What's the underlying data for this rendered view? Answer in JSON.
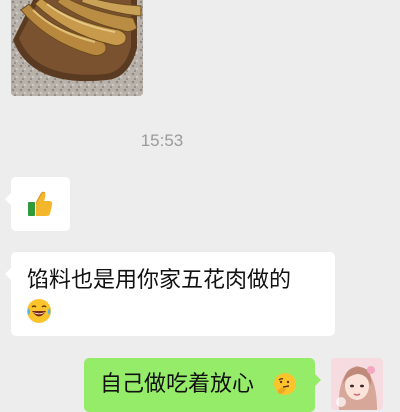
{
  "chat": {
    "timestamp": "15:53",
    "messages": [
      {
        "side": "left",
        "type": "image",
        "icon": "sausage-photo"
      },
      {
        "side": "left",
        "type": "emoji",
        "icon": "thumbs-up-icon"
      },
      {
        "side": "left",
        "type": "text",
        "text": "馅料也是用你家五花肉做的",
        "trailing_icon": "laughing-tears-emoji"
      },
      {
        "side": "right",
        "type": "text",
        "text": "自己做吃着放心",
        "trailing_icon": "thinking-face-emoji"
      }
    ]
  },
  "colors": {
    "background": "#ededed",
    "incoming_bubble": "#ffffff",
    "outgoing_bubble": "#95ec69",
    "timestamp_text": "#9a9a9a"
  }
}
